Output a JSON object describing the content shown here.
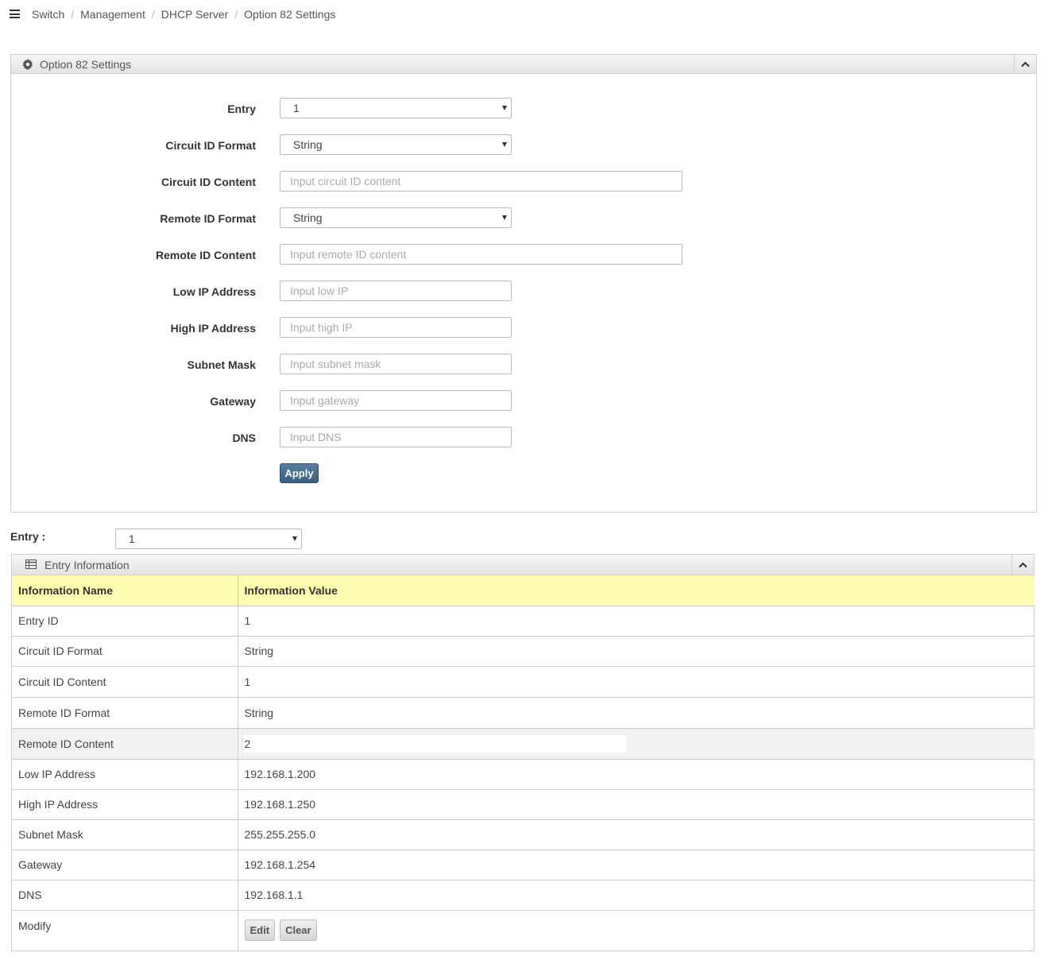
{
  "breadcrumb": [
    "Switch",
    "Management",
    "DHCP Server",
    "Option 82 Settings"
  ],
  "settings_panel": {
    "title": "Option 82 Settings",
    "fields": {
      "entry": {
        "label": "Entry",
        "value": "1"
      },
      "circuit_format": {
        "label": "Circuit ID Format",
        "value": "String"
      },
      "circuit_content": {
        "label": "Circuit ID Content",
        "placeholder": "Input circuit ID content"
      },
      "remote_format": {
        "label": "Remote ID Format",
        "value": "String"
      },
      "remote_content": {
        "label": "Remote ID Content",
        "placeholder": "Input remote ID content"
      },
      "low_ip": {
        "label": "Low IP Address",
        "placeholder": "Input low IP"
      },
      "high_ip": {
        "label": "High IP Address",
        "placeholder": "Input high IP"
      },
      "subnet": {
        "label": "Subnet Mask",
        "placeholder": "Input subnet mask"
      },
      "gateway": {
        "label": "Gateway",
        "placeholder": "Input gateway"
      },
      "dns": {
        "label": "DNS",
        "placeholder": "Input DNS"
      }
    },
    "apply_label": "Apply"
  },
  "entry_selector": {
    "label": "Entry :",
    "value": "1"
  },
  "info_panel": {
    "title": "Entry Information",
    "headers": [
      "Information Name",
      "Information Value"
    ],
    "rows": [
      {
        "name": "Entry ID",
        "value": "1"
      },
      {
        "name": "Circuit ID Format",
        "value": "String"
      },
      {
        "name": "Circuit ID Content",
        "value": "1"
      },
      {
        "name": "Remote ID Format",
        "value": "String"
      },
      {
        "name": "Remote ID Content",
        "value": "2"
      },
      {
        "name": "Low IP Address",
        "value": "192.168.1.200"
      },
      {
        "name": "High IP Address",
        "value": "192.168.1.250"
      },
      {
        "name": "Subnet Mask",
        "value": "255.255.255.0"
      },
      {
        "name": "Gateway",
        "value": "192.168.1.254"
      },
      {
        "name": "DNS",
        "value": "192.168.1.1"
      }
    ],
    "modify": {
      "name": "Modify",
      "edit_label": "Edit",
      "clear_label": "Clear"
    }
  },
  "colors": {
    "header_row": "#fdfdb1",
    "apply_button": "#3b5f80"
  },
  "icons": {
    "menu": "hamburger-icon",
    "settings": "gear-icon",
    "table": "table-icon",
    "collapse": "chevron-up-icon"
  }
}
